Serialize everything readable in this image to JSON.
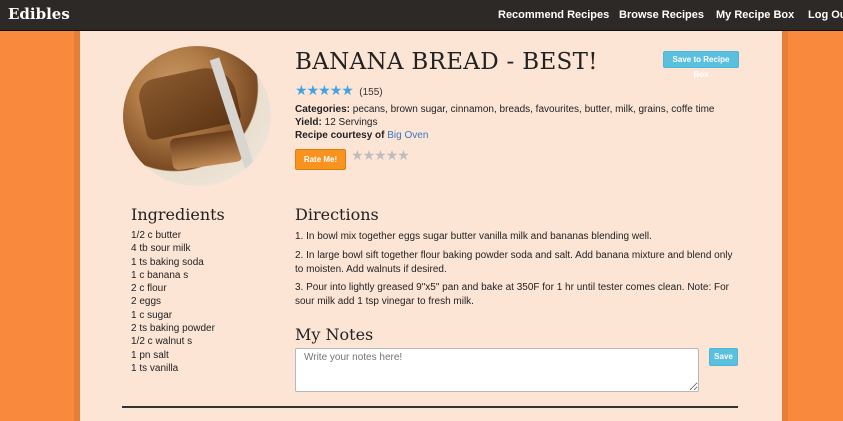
{
  "nav": {
    "brand": "Edibles",
    "items": [
      {
        "label": "Recommend Recipes"
      },
      {
        "label": "Browse Recipes"
      },
      {
        "label": "My Recipe Box"
      },
      {
        "label": "Log Out"
      }
    ]
  },
  "recipe": {
    "title": "BANANA BREAD - BEST!",
    "save_button": "Save to Recipe Box",
    "rating_count": "(155)",
    "rating_value": 5,
    "categories_label": "Categories:",
    "categories": "pecans, brown sugar, cinnamon, breads, favourites, butter, milk, grains, coffe time",
    "yield_label": "Yield:",
    "yield": "12 Servings",
    "courtesy_label": "Recipe courtesy of",
    "courtesy_link": "Big Oven",
    "rate_button": "Rate Me!",
    "image_icon": "banana-bread-photo"
  },
  "ingredients": {
    "heading": "Ingredients",
    "items": [
      "1/2 c butter",
      "4 tb sour milk",
      "1 ts baking soda",
      "1 c banana s",
      "2 c flour",
      "2 eggs",
      "1 c sugar",
      "2 ts baking powder",
      "1/2 c walnut s",
      "1 pn salt",
      "1 ts vanilla"
    ]
  },
  "directions": {
    "heading": "Directions",
    "steps": [
      "1. In bowl mix together eggs sugar butter vanilla milk and bananas blending well.",
      "2. In large bowl sift together flour baking powder soda and salt. Add banana mixture and blend only to moisten. Add walnuts if desired.",
      "3. Pour into lightly greased 9\"x5\" pan and bake at 350F for 1 hr until tester comes clean. Note: For sour milk add 1 tsp vinegar to fresh milk."
    ]
  },
  "notes": {
    "heading": "My Notes",
    "placeholder": "Write your notes here!",
    "value": "",
    "save_button": "Save"
  },
  "colors": {
    "background": "#f98a3d",
    "panel": "#fde5d6",
    "navbar": "#2d2926",
    "star_active": "#3fa3e6",
    "star_inactive": "#bdbdbd",
    "accent_blue": "#5bc0de",
    "rate_orange": "#f7931e"
  }
}
